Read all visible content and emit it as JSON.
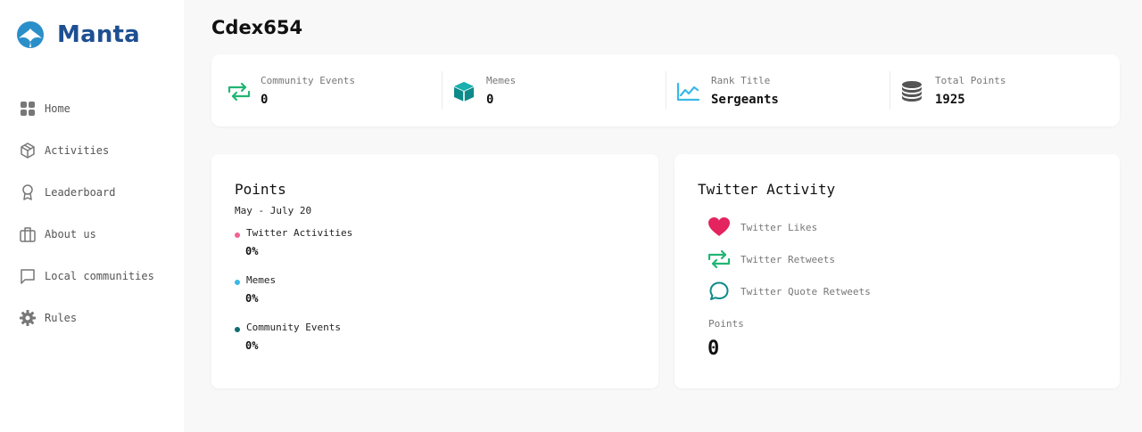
{
  "app": {
    "name": "Manta"
  },
  "sidebar": {
    "items": [
      {
        "label": "Home",
        "icon": "grid-icon"
      },
      {
        "label": "Activities",
        "icon": "box-icon"
      },
      {
        "label": "Leaderboard",
        "icon": "award-icon"
      },
      {
        "label": "About us",
        "icon": "briefcase-icon"
      },
      {
        "label": "Local communities",
        "icon": "message-square-icon"
      },
      {
        "label": "Rules",
        "icon": "gear-icon"
      }
    ]
  },
  "header": {
    "title": "Cdex654"
  },
  "stats": [
    {
      "label": "Community Events",
      "value": "0",
      "icon": "retweet-icon",
      "color": "#22b573"
    },
    {
      "label": "Memes",
      "value": "0",
      "icon": "cube-icon",
      "color": "#0f8a8a"
    },
    {
      "label": "Rank Title",
      "value": "Sergeants",
      "icon": "line-chart-icon",
      "color": "#3bb8e6"
    },
    {
      "label": "Total Points",
      "value": "1925",
      "icon": "coins-icon",
      "color": "#555555"
    }
  ],
  "points_card": {
    "title": "Points",
    "subtitle": "May - July 20",
    "legend": [
      {
        "label": "Twitter Activities",
        "value": "0%",
        "color": "#f06292"
      },
      {
        "label": "Memes",
        "value": "0%",
        "color": "#3bb8e6"
      },
      {
        "label": "Community Events",
        "value": "0%",
        "color": "#0f6e6e"
      }
    ]
  },
  "twitter_card": {
    "title": "Twitter Activity",
    "items": [
      {
        "label": "Twitter Likes",
        "icon": "heart-icon",
        "color": "#e3245e"
      },
      {
        "label": "Twitter Retweets",
        "icon": "retweet-icon",
        "color": "#22b573"
      },
      {
        "label": "Twitter Quote Retweets",
        "icon": "chat-bubble-icon",
        "color": "#0f8a8a"
      }
    ],
    "points_label": "Points",
    "points_value": "0"
  }
}
